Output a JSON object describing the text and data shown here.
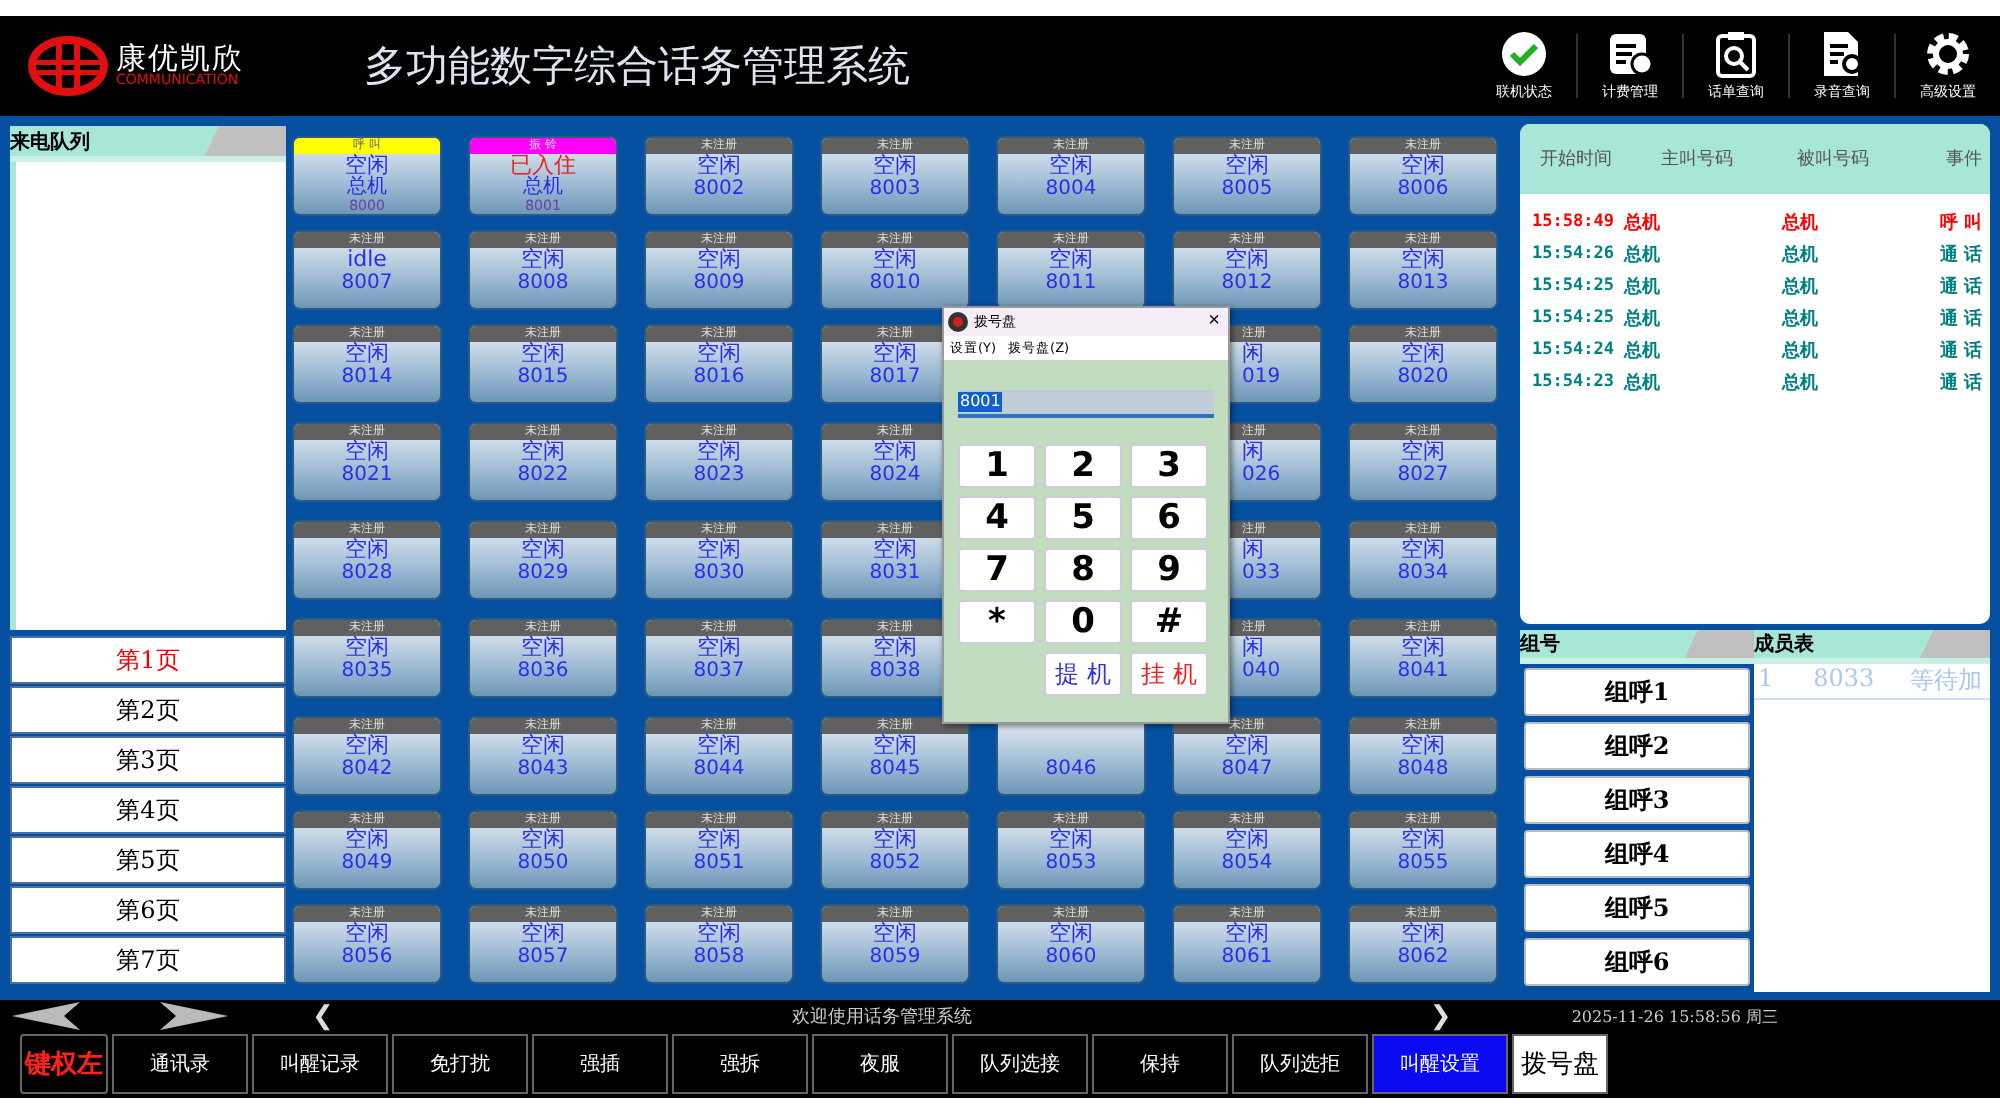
{
  "header": {
    "brand": "康优凯欣",
    "brand_sub": "COMMUNICATION",
    "title": "多功能数字综合话务管理系统",
    "tools": [
      {
        "kind": "status",
        "label": "联机状态"
      },
      {
        "kind": "billing",
        "label": "计费管理"
      },
      {
        "kind": "records",
        "label": "话单查询"
      },
      {
        "kind": "recording",
        "label": "录音查询"
      },
      {
        "kind": "settings",
        "label": "高级设置"
      }
    ]
  },
  "queue": {
    "title": "来电队列",
    "pages": [
      {
        "label": "第1页",
        "selected": true
      },
      {
        "label": "第2页",
        "selected": false
      },
      {
        "label": "第3页",
        "selected": false
      },
      {
        "label": "第4页",
        "selected": false
      },
      {
        "label": "第5页",
        "selected": false
      },
      {
        "label": "第6页",
        "selected": false
      },
      {
        "label": "第7页",
        "selected": false
      }
    ]
  },
  "tiles": [
    {
      "kind": "main",
      "header": "呼 叫",
      "color": "#ffff00",
      "state": "空闲",
      "occupied": false,
      "name": "总机",
      "ext": "8000"
    },
    {
      "kind": "main",
      "header": "振 铃",
      "color": "#ff00ff",
      "state": "已入住",
      "occupied": true,
      "name": "总机",
      "ext": "8001"
    },
    {
      "kind": "plain",
      "header": "未注册",
      "color": "#606060",
      "state": "空闲",
      "occupied": false,
      "ext": "8002"
    },
    {
      "kind": "plain",
      "header": "未注册",
      "color": "#606060",
      "state": "空闲",
      "occupied": false,
      "ext": "8003"
    },
    {
      "kind": "plain",
      "header": "未注册",
      "color": "#606060",
      "state": "空闲",
      "occupied": false,
      "ext": "8004"
    },
    {
      "kind": "plain",
      "header": "未注册",
      "color": "#606060",
      "state": "空闲",
      "occupied": false,
      "ext": "8005"
    },
    {
      "kind": "plain",
      "header": "未注册",
      "color": "#606060",
      "state": "空闲",
      "occupied": false,
      "ext": "8006"
    },
    {
      "kind": "plain",
      "header": "未注册",
      "color": "#606060",
      "state": "idle",
      "occupied": false,
      "ext": "8007"
    },
    {
      "kind": "plain",
      "header": "未注册",
      "color": "#606060",
      "state": "空闲",
      "occupied": false,
      "ext": "8008"
    },
    {
      "kind": "plain",
      "header": "未注册",
      "color": "#606060",
      "state": "空闲",
      "occupied": false,
      "ext": "8009"
    },
    {
      "kind": "plain",
      "header": "未注册",
      "color": "#606060",
      "state": "空闲",
      "occupied": false,
      "ext": "8010"
    },
    {
      "kind": "plain",
      "header": "未注册",
      "color": "#606060",
      "state": "空闲",
      "occupied": false,
      "ext": "8011"
    },
    {
      "kind": "plain",
      "header": "未注册",
      "color": "#606060",
      "state": "空闲",
      "occupied": false,
      "ext": "8012"
    },
    {
      "kind": "plain",
      "header": "未注册",
      "color": "#606060",
      "state": "空闲",
      "occupied": false,
      "ext": "8013"
    },
    {
      "kind": "plain",
      "header": "未注册",
      "color": "#606060",
      "state": "空闲",
      "occupied": false,
      "ext": "8014"
    },
    {
      "kind": "plain",
      "header": "未注册",
      "color": "#606060",
      "state": "空闲",
      "occupied": false,
      "ext": "8015"
    },
    {
      "kind": "plain",
      "header": "未注册",
      "color": "#606060",
      "state": "空闲",
      "occupied": false,
      "ext": "8016"
    },
    {
      "kind": "plain",
      "header": "未注册",
      "color": "#606060",
      "state": "空闲",
      "occupied": false,
      "ext": "8017"
    },
    {
      "kind": "covered"
    },
    {
      "kind": "clipped",
      "header": "注册",
      "color": "#606060",
      "state": "闲",
      "occupied": false,
      "ext": "019"
    },
    {
      "kind": "plain",
      "header": "未注册",
      "color": "#606060",
      "state": "空闲",
      "occupied": false,
      "ext": "8020"
    },
    {
      "kind": "plain",
      "header": "未注册",
      "color": "#606060",
      "state": "空闲",
      "occupied": false,
      "ext": "8021"
    },
    {
      "kind": "plain",
      "header": "未注册",
      "color": "#606060",
      "state": "空闲",
      "occupied": false,
      "ext": "8022"
    },
    {
      "kind": "plain",
      "header": "未注册",
      "color": "#606060",
      "state": "空闲",
      "occupied": false,
      "ext": "8023"
    },
    {
      "kind": "plain",
      "header": "未注册",
      "color": "#606060",
      "state": "空闲",
      "occupied": false,
      "ext": "8024"
    },
    {
      "kind": "covered"
    },
    {
      "kind": "clipped",
      "header": "注册",
      "color": "#606060",
      "state": "闲",
      "occupied": false,
      "ext": "026"
    },
    {
      "kind": "plain",
      "header": "未注册",
      "color": "#606060",
      "state": "空闲",
      "occupied": false,
      "ext": "8027"
    },
    {
      "kind": "plain",
      "header": "未注册",
      "color": "#606060",
      "state": "空闲",
      "occupied": false,
      "ext": "8028"
    },
    {
      "kind": "plain",
      "header": "未注册",
      "color": "#606060",
      "state": "空闲",
      "occupied": false,
      "ext": "8029"
    },
    {
      "kind": "plain",
      "header": "未注册",
      "color": "#606060",
      "state": "空闲",
      "occupied": false,
      "ext": "8030"
    },
    {
      "kind": "plain",
      "header": "未注册",
      "color": "#606060",
      "state": "空闲",
      "occupied": false,
      "ext": "8031"
    },
    {
      "kind": "covered"
    },
    {
      "kind": "clipped",
      "header": "注册",
      "color": "#606060",
      "state": "闲",
      "occupied": false,
      "ext": "033"
    },
    {
      "kind": "plain",
      "header": "未注册",
      "color": "#606060",
      "state": "空闲",
      "occupied": false,
      "ext": "8034"
    },
    {
      "kind": "plain",
      "header": "未注册",
      "color": "#606060",
      "state": "空闲",
      "occupied": false,
      "ext": "8035"
    },
    {
      "kind": "plain",
      "header": "未注册",
      "color": "#606060",
      "state": "空闲",
      "occupied": false,
      "ext": "8036"
    },
    {
      "kind": "plain",
      "header": "未注册",
      "color": "#606060",
      "state": "空闲",
      "occupied": false,
      "ext": "8037"
    },
    {
      "kind": "plain",
      "header": "未注册",
      "color": "#606060",
      "state": "空闲",
      "occupied": false,
      "ext": "8038"
    },
    {
      "kind": "covered"
    },
    {
      "kind": "clipped",
      "header": "注册",
      "color": "#606060",
      "state": "闲",
      "occupied": false,
      "ext": "040"
    },
    {
      "kind": "plain",
      "header": "未注册",
      "color": "#606060",
      "state": "空闲",
      "occupied": false,
      "ext": "8041"
    },
    {
      "kind": "plain",
      "header": "未注册",
      "color": "#606060",
      "state": "空闲",
      "occupied": false,
      "ext": "8042"
    },
    {
      "kind": "plain",
      "header": "未注册",
      "color": "#606060",
      "state": "空闲",
      "occupied": false,
      "ext": "8043"
    },
    {
      "kind": "plain",
      "header": "未注册",
      "color": "#606060",
      "state": "空闲",
      "occupied": false,
      "ext": "8044"
    },
    {
      "kind": "plain",
      "header": "未注册",
      "color": "#606060",
      "state": "空闲",
      "occupied": false,
      "ext": "8045"
    },
    {
      "kind": "plain",
      "ext": "8046"
    },
    {
      "kind": "plain",
      "header": "未注册",
      "color": "#606060",
      "state": "空闲",
      "occupied": false,
      "ext": "8047"
    },
    {
      "kind": "plain",
      "header": "未注册",
      "color": "#606060",
      "state": "空闲",
      "occupied": false,
      "ext": "8048"
    },
    {
      "kind": "plain",
      "header": "未注册",
      "color": "#606060",
      "state": "空闲",
      "occupied": false,
      "ext": "8049"
    },
    {
      "kind": "plain",
      "header": "未注册",
      "color": "#606060",
      "state": "空闲",
      "occupied": false,
      "ext": "8050"
    },
    {
      "kind": "plain",
      "header": "未注册",
      "color": "#606060",
      "state": "空闲",
      "occupied": false,
      "ext": "8051"
    },
    {
      "kind": "plain",
      "header": "未注册",
      "color": "#606060",
      "state": "空闲",
      "occupied": false,
      "ext": "8052"
    },
    {
      "kind": "plain",
      "header": "未注册",
      "color": "#606060",
      "state": "空闲",
      "occupied": false,
      "ext": "8053"
    },
    {
      "kind": "plain",
      "header": "未注册",
      "color": "#606060",
      "state": "空闲",
      "occupied": false,
      "ext": "8054"
    },
    {
      "kind": "plain",
      "header": "未注册",
      "color": "#606060",
      "state": "空闲",
      "occupied": false,
      "ext": "8055"
    },
    {
      "kind": "plain",
      "header": "未注册",
      "color": "#606060",
      "state": "空闲",
      "occupied": false,
      "ext": "8056"
    },
    {
      "kind": "plain",
      "header": "未注册",
      "color": "#606060",
      "state": "空闲",
      "occupied": false,
      "ext": "8057"
    },
    {
      "kind": "plain",
      "header": "未注册",
      "color": "#606060",
      "state": "空闲",
      "occupied": false,
      "ext": "8058"
    },
    {
      "kind": "plain",
      "header": "未注册",
      "color": "#606060",
      "state": "空闲",
      "occupied": false,
      "ext": "8059"
    },
    {
      "kind": "plain",
      "header": "未注册",
      "color": "#606060",
      "state": "空闲",
      "occupied": false,
      "ext": "8060"
    },
    {
      "kind": "plain",
      "header": "未注册",
      "color": "#606060",
      "state": "空闲",
      "occupied": false,
      "ext": "8061"
    },
    {
      "kind": "plain",
      "header": "未注册",
      "color": "#606060",
      "state": "空闲",
      "occupied": false,
      "ext": "8062"
    }
  ],
  "dialpad": {
    "title": "拨号盘",
    "menu": [
      "设置(Y)",
      "拨号盘(Z)"
    ],
    "close": "×",
    "value": "8001",
    "keys": [
      "1",
      "2",
      "3",
      "4",
      "5",
      "6",
      "7",
      "8",
      "9",
      "*",
      "0",
      "#"
    ],
    "actions": [
      {
        "kind": "pickup",
        "label": "提 机"
      },
      {
        "kind": "hangup",
        "label": "挂 机"
      }
    ]
  },
  "call_log": {
    "columns": [
      "开始时间",
      "主叫号码",
      "被叫号码",
      "事件"
    ],
    "rows": [
      {
        "time": "15:58:49",
        "caller": "总机",
        "callee": "总机",
        "event": "呼 叫",
        "color": "#ff0000"
      },
      {
        "time": "15:54:26",
        "caller": "总机",
        "callee": "总机",
        "event": "通 话",
        "color": "#008080"
      },
      {
        "time": "15:54:25",
        "caller": "总机",
        "callee": "总机",
        "event": "通 话",
        "color": "#008080"
      },
      {
        "time": "15:54:25",
        "caller": "总机",
        "callee": "总机",
        "event": "通 话",
        "color": "#008080"
      },
      {
        "time": "15:54:24",
        "caller": "总机",
        "callee": "总机",
        "event": "通 话",
        "color": "#008080"
      },
      {
        "time": "15:54:23",
        "caller": "总机",
        "callee": "总机",
        "event": "通 话",
        "color": "#008080"
      }
    ]
  },
  "groups": {
    "title": "组号",
    "items": [
      "组呼1",
      "组呼2",
      "组呼3",
      "组呼4",
      "组呼5",
      "组呼6"
    ]
  },
  "members": {
    "title": "成员表",
    "rows": [
      {
        "index": "1",
        "ext": "8033",
        "status": "等待加"
      }
    ]
  },
  "status_bar": {
    "prev": "❮",
    "message": "欢迎使用话务管理系统",
    "next": "❯",
    "datetime": "2025-11-26 15:58:56 周三"
  },
  "functions": [
    {
      "kind": "key",
      "label": "键权左",
      "selected": false
    },
    {
      "kind": "normal",
      "label": "通讯录",
      "selected": false
    },
    {
      "kind": "normal",
      "label": "叫醒记录",
      "selected": false
    },
    {
      "kind": "normal",
      "label": "免打扰",
      "selected": false
    },
    {
      "kind": "normal",
      "label": "强插",
      "selected": false
    },
    {
      "kind": "normal",
      "label": "强拆",
      "selected": false
    },
    {
      "kind": "normal",
      "label": "夜服",
      "selected": false
    },
    {
      "kind": "normal",
      "label": "队列选接",
      "selected": false
    },
    {
      "kind": "normal",
      "label": "保持",
      "selected": false
    },
    {
      "kind": "normal",
      "label": "队列选拒",
      "selected": false
    },
    {
      "kind": "normal",
      "label": "叫醒设置",
      "selected": true
    },
    {
      "kind": "dial",
      "label": "拨号盘",
      "selected": false
    }
  ]
}
